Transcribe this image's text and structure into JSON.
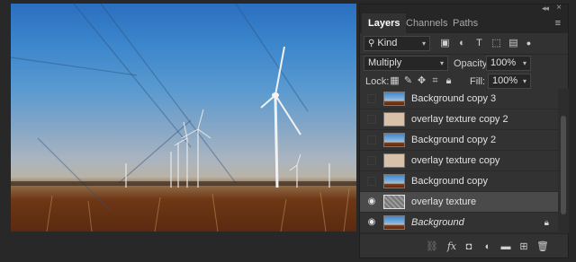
{
  "tabs": [
    {
      "label": "Layers"
    },
    {
      "label": "Channels"
    },
    {
      "label": "Paths"
    }
  ],
  "filter": {
    "kind_label": "Kind"
  },
  "blend": {
    "mode": "Multiply",
    "opacity_label": "Opacity:",
    "opacity_value": "100%"
  },
  "lock": {
    "label": "Lock:",
    "fill_label": "Fill:",
    "fill_value": "100%"
  },
  "layers": [
    {
      "name": "Background copy 3",
      "visible": false,
      "thumb": "sky-icon"
    },
    {
      "name": "overlay texture copy 2",
      "visible": false,
      "thumb": "beige-texture-icon"
    },
    {
      "name": "Background copy 2",
      "visible": false,
      "thumb": "sky-icon"
    },
    {
      "name": "overlay texture copy",
      "visible": false,
      "thumb": "beige-texture-icon"
    },
    {
      "name": "Background copy",
      "visible": false,
      "thumb": "sky-icon"
    },
    {
      "name": "overlay texture",
      "visible": true,
      "selected": true,
      "thumb": "gray-texture-icon"
    },
    {
      "name": "Background",
      "visible": true,
      "locked": true,
      "thumb": "sky-icon"
    }
  ],
  "colors": {
    "panel": "#323232",
    "selected_row": "#4a4a4a",
    "tab_bar": "#262626"
  }
}
